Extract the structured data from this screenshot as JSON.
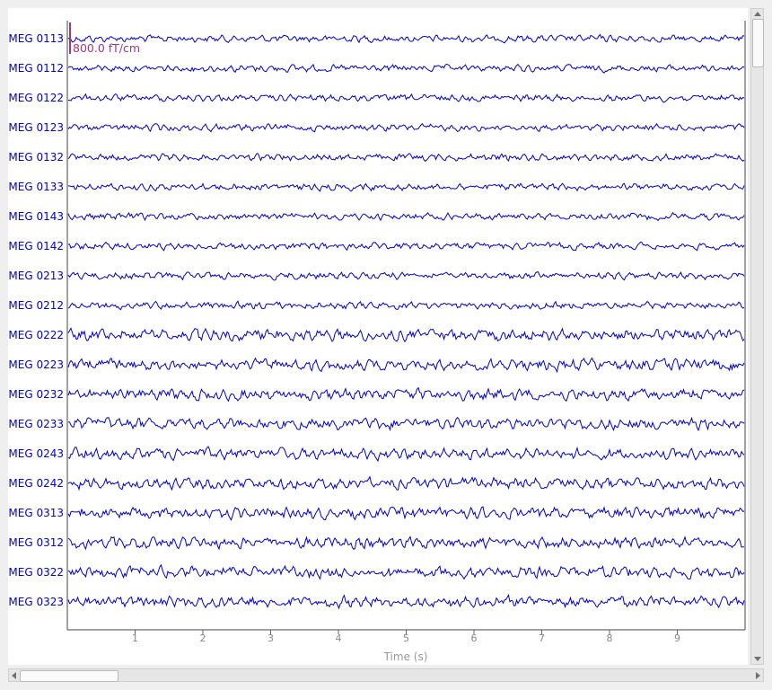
{
  "channels": [
    "MEG 0113",
    "MEG 0112",
    "MEG 0122",
    "MEG 0123",
    "MEG 0132",
    "MEG 0133",
    "MEG 0143",
    "MEG 0142",
    "MEG 0213",
    "MEG 0212",
    "MEG 0222",
    "MEG 0223",
    "MEG 0232",
    "MEG 0233",
    "MEG 0243",
    "MEG 0242",
    "MEG 0313",
    "MEG 0312",
    "MEG 0322",
    "MEG 0323"
  ],
  "axis": {
    "xlabel": "Time (s)",
    "xlim": [
      0,
      10
    ],
    "ticks": [
      "1",
      "2",
      "3",
      "4",
      "5",
      "6",
      "7",
      "8",
      "9"
    ]
  },
  "scale_bar": {
    "label": "800.0 fT/cm"
  },
  "colors": {
    "trace": "#0000cc",
    "channel_label": "#0000cc",
    "scale_bar": "#a03a7a",
    "axis": "#444444"
  }
}
